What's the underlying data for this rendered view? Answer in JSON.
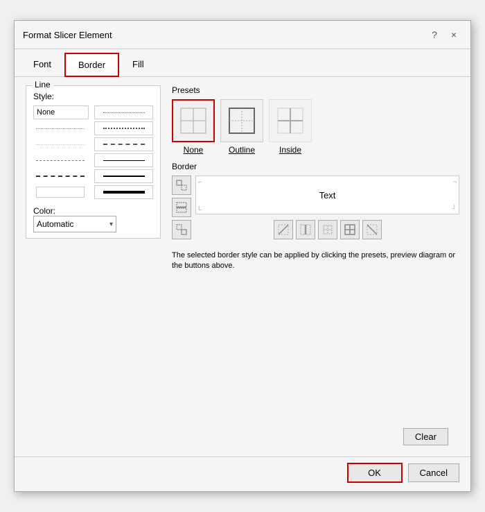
{
  "dialog": {
    "title": "Format Slicer Element",
    "help_icon": "?",
    "close_icon": "×"
  },
  "tabs": [
    {
      "label": "Font",
      "active": false,
      "highlighted": false
    },
    {
      "label": "Border",
      "active": true,
      "highlighted": true
    },
    {
      "label": "Fill",
      "active": false,
      "highlighted": false
    }
  ],
  "line_section": {
    "label": "Line",
    "style_label": "Style:",
    "none_label": "None"
  },
  "color_section": {
    "label": "Color:",
    "value": "Automatic"
  },
  "presets_section": {
    "label": "Presets",
    "items": [
      {
        "name": "None",
        "selected": true
      },
      {
        "name": "Outline",
        "selected": false
      },
      {
        "name": "Inside",
        "selected": false
      }
    ]
  },
  "border_section": {
    "label": "Border",
    "preview_text": "Text"
  },
  "info_text": "The selected border style can be applied by clicking the presets, preview diagram or the buttons above.",
  "buttons": {
    "clear": "Clear",
    "ok": "OK",
    "cancel": "Cancel"
  }
}
